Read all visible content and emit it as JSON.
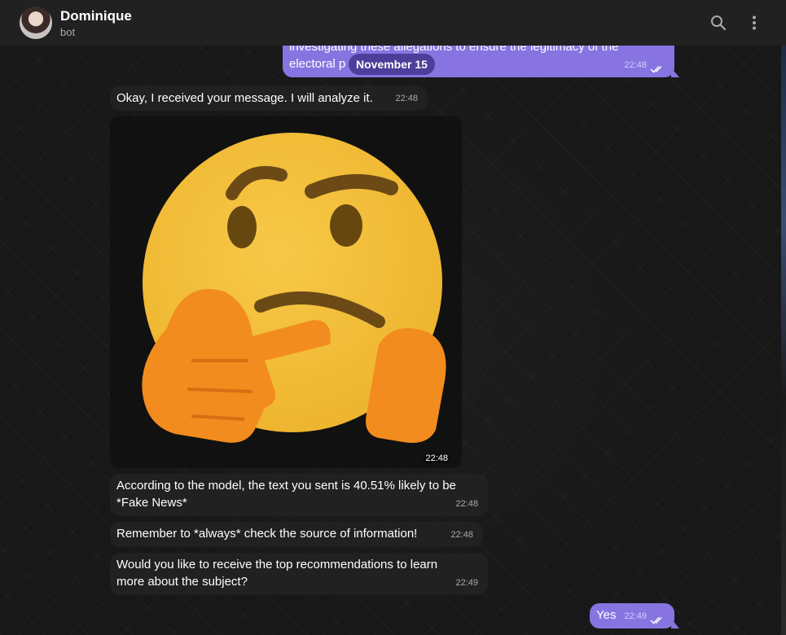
{
  "header": {
    "name": "Dominique",
    "status": "bot",
    "icons": [
      "search-icon",
      "more-vert-icon"
    ]
  },
  "date_pill": "November 15",
  "messages": [
    {
      "side": "out",
      "text": "investigating these allegations to ensure the legitimacy of the electoral p",
      "line1": "investigating these allegations to ensure the legitimacy of the",
      "line2": "electoral p",
      "time": "22:48",
      "read": true
    },
    {
      "side": "in",
      "text": "Okay, I received your message. I will analyze it.",
      "time": "22:48"
    },
    {
      "side": "in",
      "type": "sticker",
      "sticker": "thinking-face",
      "time": "22:48"
    },
    {
      "side": "in",
      "line1": "According to the model, the text you sent is 40.51% likely to be",
      "line2": "*Fake News*",
      "time": "22:48"
    },
    {
      "side": "in",
      "text": "Remember to *always* check the source of information!",
      "time": "22:48"
    },
    {
      "side": "in",
      "line1": "Would you like to receive the top recommendations to learn",
      "line2": "more about the subject?",
      "time": "22:49"
    },
    {
      "side": "out",
      "text": "Yes",
      "time": "22:49",
      "read": true
    }
  ],
  "colors": {
    "outgoing_bubble": "#8774e1",
    "incoming_bubble": "#212121",
    "header": "#212121",
    "date_pill": "#4c3e9a"
  }
}
